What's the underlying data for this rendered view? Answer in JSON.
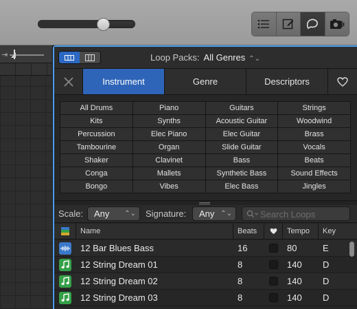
{
  "toolbar": {
    "zoom_slider_value": 0.7,
    "buttons": [
      {
        "icon": "list-icon"
      },
      {
        "icon": "note-edit-icon"
      },
      {
        "icon": "loop-browser-icon",
        "active": true
      },
      {
        "icon": "media-browser-icon"
      }
    ]
  },
  "header": {
    "loop_packs_label": "Loop Packs:",
    "loop_packs_value": "All Genres"
  },
  "tabs": {
    "instrument": "Instrument",
    "genre": "Genre",
    "descriptors": "Descriptors"
  },
  "keywords": [
    "All Drums",
    "Piano",
    "Guitars",
    "Strings",
    "Kits",
    "Synths",
    "Acoustic Guitar",
    "Woodwind",
    "Percussion",
    "Elec Piano",
    "Elec Guitar",
    "Brass",
    "Tambourine",
    "Organ",
    "Slide Guitar",
    "Vocals",
    "Shaker",
    "Clavinet",
    "Bass",
    "Beats",
    "Conga",
    "Mallets",
    "Synthetic Bass",
    "Sound Effects",
    "Bongo",
    "Vibes",
    "Elec Bass",
    "Jingles"
  ],
  "filters": {
    "scale_label": "Scale:",
    "scale_value": "Any",
    "signature_label": "Signature:",
    "signature_value": "Any",
    "search_placeholder": "Search Loops"
  },
  "table": {
    "headers": {
      "name": "Name",
      "beats": "Beats",
      "tempo": "Tempo",
      "key": "Key"
    },
    "rows": [
      {
        "type": "audio",
        "name": "12 Bar Blues Bass",
        "beats": "16",
        "tempo": "80",
        "key": "E"
      },
      {
        "type": "midi",
        "name": "12 String Dream 01",
        "beats": "8",
        "tempo": "140",
        "key": "D"
      },
      {
        "type": "midi",
        "name": "12 String Dream 02",
        "beats": "8",
        "tempo": "140",
        "key": "D"
      },
      {
        "type": "midi",
        "name": "12 String Dream 03",
        "beats": "8",
        "tempo": "140",
        "key": "D"
      }
    ]
  },
  "colors": {
    "accent": "#2f65b8",
    "focus_border": "#4aa0f0",
    "audio_loop": "#3a79c9",
    "midi_loop": "#35a048"
  }
}
